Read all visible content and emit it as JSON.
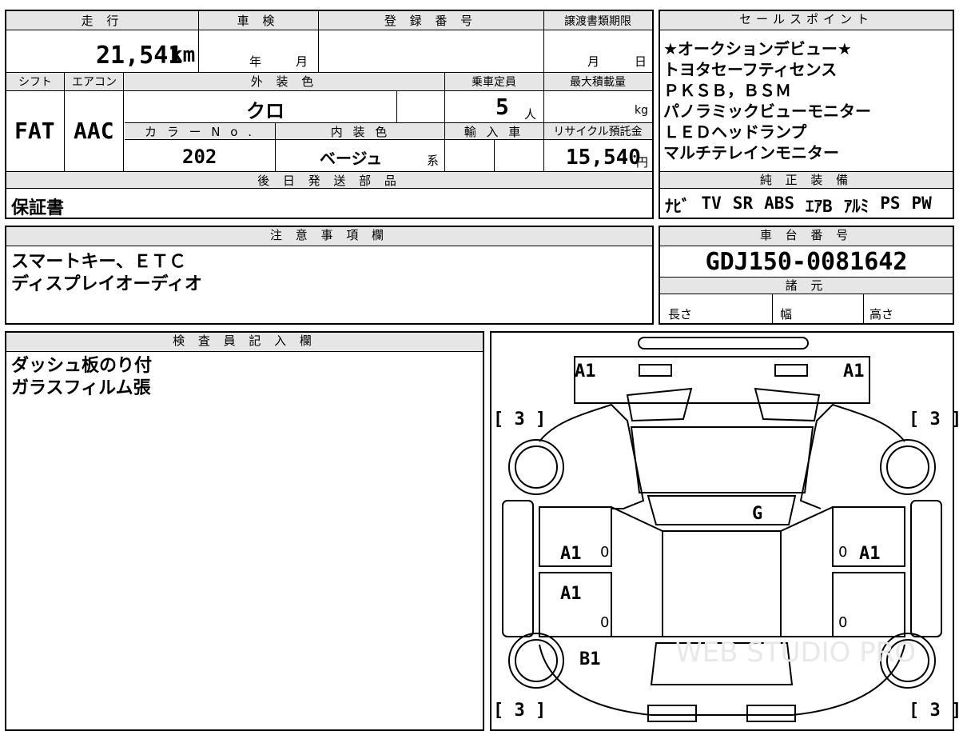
{
  "labels": {
    "mileage": "走 行",
    "shaken": "車 検",
    "registration": "登 録 番 号",
    "transfer_deadline": "譲渡書類期限",
    "sales_points": "セールスポイント",
    "shift": "シフト",
    "aircon": "エアコン",
    "exterior_color": "外 装 色",
    "capacity": "乗車定員",
    "max_load": "最大積載量",
    "color_no": "カ ラ ー N o .",
    "interior_color": "内 装 色",
    "import": "輸 入 車",
    "recycle": "リサイクル預託金",
    "later_parts": "後 日 発 送 部 品",
    "equipment": "純 正 装 備",
    "notes": "注 意 事 項 欄",
    "chassis": "車 台 番 号",
    "specs": "諸 元",
    "inspector": "検 査 員 記 入 欄"
  },
  "values": {
    "mileage": "21,541",
    "mileage_unit": "km",
    "year_unit": "年",
    "month_unit": "月",
    "deadline_month": "月",
    "deadline_day": "日",
    "shift": "FAT",
    "aircon": "AAC",
    "exterior_color": "クロ",
    "capacity": "5",
    "capacity_unit": "人",
    "load_unit": "kg",
    "color_no": "202",
    "interior_color": "ベージュ",
    "interior_suffix": "系",
    "recycle": "15,540",
    "recycle_unit": "円",
    "later_parts": "保証書",
    "chassis": "GDJ150-0081642",
    "length_label": "長さ",
    "width_label": "幅",
    "height_label": "高さ"
  },
  "sales_points": [
    "★オークションデビュー★",
    "トヨタセーフティセンス",
    "ＰＫＳＢ，ＢＳＭ",
    "パノラミックビューモニター",
    "ＬＥＤヘッドランプ",
    "マルチテレインモニター"
  ],
  "equipment": [
    "ﾅﾋﾞ",
    "TV",
    "SR",
    "ABS",
    "ｴｱB",
    "ｱﾙﾐ",
    "PS",
    "PW"
  ],
  "notes": [
    "スマートキー、ＥＴＣ",
    "ディスプレイオーディオ"
  ],
  "inspector_notes": [
    "ダッシュ板のり付",
    "ガラスフィルム張"
  ],
  "diagram": {
    "front_left": "A1",
    "front_right": "A1",
    "tire_fl": "[ 3 ]",
    "tire_fr": "[ 3 ]",
    "tire_rl": "[ 3 ]",
    "tire_rr": "[ 3 ]",
    "glass": "G",
    "door_fl": "A1",
    "door_fr": "A1",
    "door_rl": "A1",
    "rear_l": "B1",
    "zero": "0",
    "watermark": "WEB STUDIO PRO"
  }
}
